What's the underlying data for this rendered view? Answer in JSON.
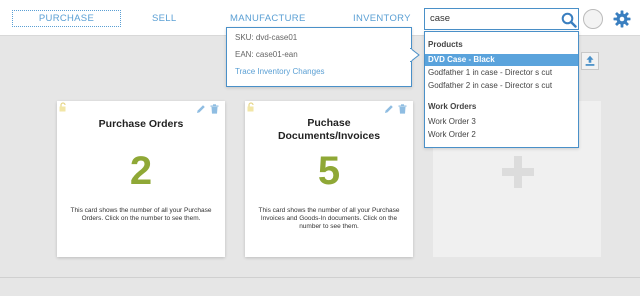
{
  "nav": {
    "purchase": "PURCHASE",
    "sell": "SELL",
    "manufacture": "MANUFACTURE",
    "inventory": "INVENTORY"
  },
  "search": {
    "value": "case"
  },
  "tooltip": {
    "sku": "SKU: dvd-case01",
    "ean": "EAN: case01-ean",
    "trace": "Trace Inventory Changes"
  },
  "dropdown": {
    "products_header": "Products",
    "products": [
      "DVD Case - Black",
      "Godfather 1 in case - Director s cut",
      "Godfather 2 in case - Director s cut"
    ],
    "work_orders_header": "Work Orders",
    "work_orders": [
      "Work Order 3",
      "Work Order 2"
    ]
  },
  "cards": [
    {
      "title": "Purchase Orders",
      "number": "2",
      "desc": "This card shows the number of all your Purchase Orders. Click on the number to see them."
    },
    {
      "title": "Puchase Documents/Invoices",
      "number": "5",
      "desc": "This card shows the number of all your Purchase Invoices and Goods-In documents. Click on the number to see them."
    }
  ],
  "colors": {
    "accent": "#5a9fd4",
    "number": "#8fa836",
    "selected": "#5aa3dc"
  },
  "icons": [
    "search-icon",
    "gear-icon",
    "upload-icon",
    "lock-icon",
    "edit-icon",
    "trash-icon",
    "plus-icon"
  ]
}
